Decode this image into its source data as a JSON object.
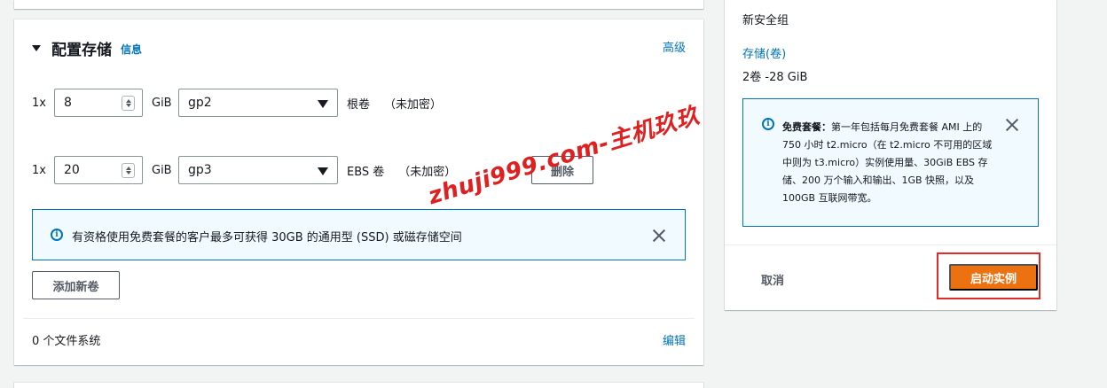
{
  "storage_section": {
    "title": "配置存储",
    "info_link": "信息",
    "advanced_link": "高级",
    "volumes": [
      {
        "multiplier": "1x",
        "size": "8",
        "unit": "GiB",
        "type": "gp2",
        "label": "根卷",
        "encryption": "（未加密）"
      },
      {
        "multiplier": "1x",
        "size": "20",
        "unit": "GiB",
        "type": "gp3",
        "label": "EBS 卷",
        "encryption": "（未加密）",
        "delete_label": "删除"
      }
    ],
    "free_tier_alert": "有资格使用免费套餐的客户最多可获得 30GB 的通用型 (SSD) 或磁存储空间",
    "add_volume_label": "添加新卷",
    "file_systems": "0 个文件系统",
    "edit_link": "编辑"
  },
  "summary_panel": {
    "security_group": "新安全组",
    "storage_heading": "存储(卷)",
    "storage_value": "2卷 -28 GiB",
    "free_tier": {
      "title": "免费套餐：",
      "body": "第一年包括每月免费套餐 AMI 上的 750 小时 t2.micro（在 t2.micro 不可用的区域中则为 t3.micro）实例使用量、30GiB EBS 存储、200 万个输入和输出、1GB 快照，以及 100GB 互联网带宽。"
    },
    "cancel_label": "取消",
    "launch_label": "启动实例"
  },
  "watermark": "zhuji999.com-主机玖玖",
  "colors": {
    "accent": "#0073bb",
    "primary_button": "#ec7211",
    "highlight_frame": "#e02b2b"
  }
}
